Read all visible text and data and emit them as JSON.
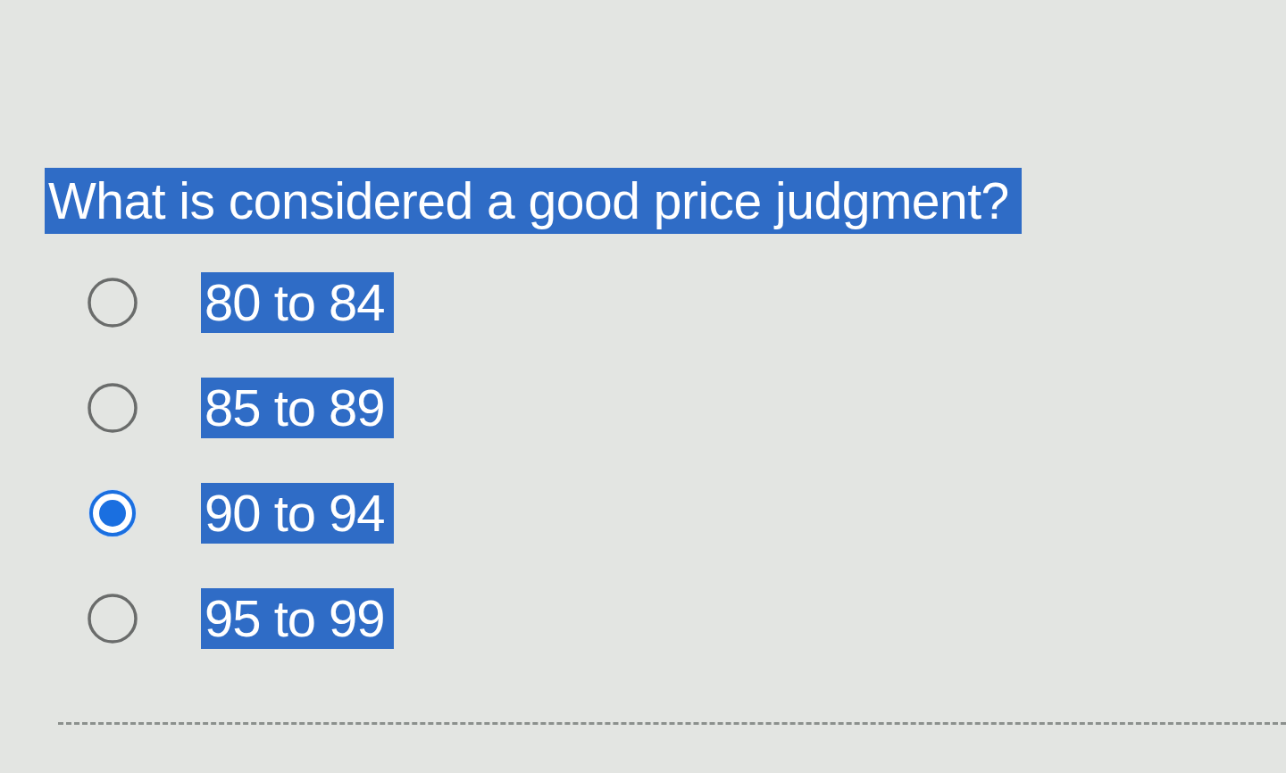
{
  "question": {
    "text": "What is considered a good price judgment?",
    "highlighted": true
  },
  "options": [
    {
      "label": "80 to 84",
      "selected": false,
      "highlighted": true
    },
    {
      "label": "85 to 89",
      "selected": false,
      "highlighted": true
    },
    {
      "label": "90 to 94",
      "selected": true,
      "highlighted": true
    },
    {
      "label": "95 to 99",
      "selected": false,
      "highlighted": true
    }
  ]
}
